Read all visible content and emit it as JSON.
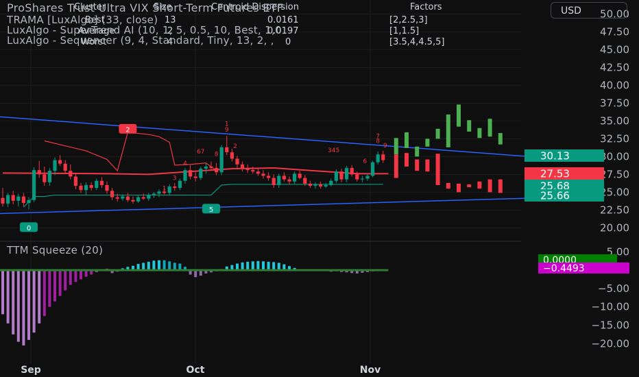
{
  "header": {
    "title": "ProShares Trust Ultra VIX Short-Term Futures ETF",
    "currency": "USD",
    "indicators": [
      "TRAMA [LuxAlgo] (33, close)",
      "LuxAlgo - SuperTrend AI (10, 1, 5, 0.5, 10, Best, 1,0",
      "LuxAlgo - Sequencer (9, 4, Standard, Tiny, 13, 2, ,"
    ]
  },
  "cluster_table": {
    "columns": [
      "Cluster",
      "Size",
      "Centroid Dispersion",
      "Factors"
    ],
    "rows": [
      [
        "Best",
        "13",
        "0.0161",
        "[2,2.5,3]"
      ],
      [
        "Average",
        "2",
        "0.0197",
        "[1,1.5]"
      ],
      [
        "Worst",
        "4",
        "0",
        "[3.5,4,4.5,5]"
      ]
    ]
  },
  "price_badges": [
    {
      "value": "30.13",
      "color": "#089981"
    },
    {
      "value": "27.53",
      "color": "#f23645"
    },
    {
      "value": "25.68",
      "color": "#089981"
    },
    {
      "value": "25.66",
      "color": "#089981"
    }
  ],
  "squeeze": {
    "title": "TTM Squeeze (20)",
    "badges": [
      {
        "value": "0.0000",
        "color": "#089981"
      },
      {
        "value": "−0.4493",
        "color": "#cc00cc"
      }
    ]
  },
  "chart_data": {
    "type": "candlestick",
    "x_ticks": [
      "Sep",
      "Oct",
      "Nov"
    ],
    "price_axis": {
      "ticks": [
        "20.00",
        "22.50",
        "25.00",
        "27.50",
        "30.00",
        "32.50",
        "35.00",
        "37.50",
        "40.00",
        "42.50",
        "45.00",
        "47.50",
        "50.00"
      ],
      "ylim": [
        18.5,
        51
      ]
    },
    "osc_axis": {
      "ticks": [
        "5.00",
        "0.00",
        "−5.00",
        "−10.00",
        "−15.00",
        "−20.00"
      ],
      "ylim": [
        -22,
        6
      ]
    },
    "sequencer_labels": [
      {
        "text": "2",
        "x": 24,
        "y": 33.8,
        "boxed": true,
        "color": "#f23645"
      },
      {
        "text": "0",
        "x": 5,
        "y": 20.0,
        "boxed": true,
        "color": "#089981"
      },
      {
        "text": "5",
        "x": 40,
        "y": 22.6,
        "boxed": true,
        "color": "#089981"
      },
      {
        "text": "1",
        "x": 31,
        "y": 25.3,
        "boxed": false,
        "color": "#f23645"
      },
      {
        "text": "3",
        "x": 33,
        "y": 26.7,
        "boxed": false,
        "color": "#f23645"
      },
      {
        "text": "4",
        "x": 35,
        "y": 28.8,
        "boxed": false,
        "color": "#f23645"
      },
      {
        "text": "67",
        "x": 38,
        "y": 30.4,
        "boxed": false,
        "color": "#f23645"
      },
      {
        "text": "8",
        "x": 41,
        "y": 30.1,
        "boxed": false,
        "color": "#f23645"
      },
      {
        "text": "1",
        "x": 43,
        "y": 34.3,
        "boxed": false,
        "color": "#f23645"
      },
      {
        "text": "9",
        "x": 43,
        "y": 33.5,
        "boxed": false,
        "color": "#f23645"
      },
      {
        "text": "2",
        "x": 44.6,
        "y": 31.2,
        "boxed": false,
        "color": "#f23645"
      },
      {
        "text": "345",
        "x": 63.5,
        "y": 30.6,
        "boxed": false,
        "color": "#f23645"
      },
      {
        "text": "6",
        "x": 69.5,
        "y": 29.1,
        "boxed": false,
        "color": "#f23645"
      },
      {
        "text": "7",
        "x": 72,
        "y": 32.6,
        "boxed": false,
        "color": "#f23645"
      },
      {
        "text": "8",
        "x": 72,
        "y": 31.9,
        "boxed": false,
        "color": "#f23645"
      },
      {
        "text": "9",
        "x": 73.4,
        "y": 31.3,
        "boxed": false,
        "color": "#f23645"
      }
    ],
    "candles": [
      {
        "o": 24.2,
        "h": 25.6,
        "l": 23.0,
        "c": 23.4
      },
      {
        "o": 23.4,
        "h": 24.9,
        "l": 22.9,
        "c": 24.6
      },
      {
        "o": 24.6,
        "h": 25.2,
        "l": 23.3,
        "c": 23.8
      },
      {
        "o": 23.8,
        "h": 24.8,
        "l": 23.0,
        "c": 24.4
      },
      {
        "o": 24.4,
        "h": 24.9,
        "l": 23.0,
        "c": 23.5
      },
      {
        "o": 23.5,
        "h": 24.3,
        "l": 22.6,
        "c": 23.9
      },
      {
        "o": 23.9,
        "h": 28.5,
        "l": 23.6,
        "c": 28.1
      },
      {
        "o": 28.1,
        "h": 29.4,
        "l": 27.0,
        "c": 27.5
      },
      {
        "o": 27.5,
        "h": 28.6,
        "l": 25.9,
        "c": 26.4
      },
      {
        "o": 26.4,
        "h": 28.4,
        "l": 25.9,
        "c": 28.0
      },
      {
        "o": 28.0,
        "h": 29.9,
        "l": 27.4,
        "c": 29.5
      },
      {
        "o": 29.5,
        "h": 30.2,
        "l": 28.7,
        "c": 29.0
      },
      {
        "o": 29.0,
        "h": 29.5,
        "l": 27.6,
        "c": 28.0
      },
      {
        "o": 28.0,
        "h": 28.9,
        "l": 26.8,
        "c": 27.2
      },
      {
        "o": 27.2,
        "h": 27.7,
        "l": 25.4,
        "c": 25.9
      },
      {
        "o": 25.9,
        "h": 26.3,
        "l": 24.9,
        "c": 25.3
      },
      {
        "o": 25.3,
        "h": 26.4,
        "l": 24.6,
        "c": 26.0
      },
      {
        "o": 26.0,
        "h": 26.4,
        "l": 25.2,
        "c": 25.6
      },
      {
        "o": 25.6,
        "h": 26.9,
        "l": 25.3,
        "c": 26.6
      },
      {
        "o": 26.6,
        "h": 27.1,
        "l": 25.6,
        "c": 26.0
      },
      {
        "o": 26.0,
        "h": 26.5,
        "l": 24.8,
        "c": 25.2
      },
      {
        "o": 25.2,
        "h": 25.6,
        "l": 23.9,
        "c": 24.3
      },
      {
        "o": 24.3,
        "h": 24.8,
        "l": 23.7,
        "c": 24.1
      },
      {
        "o": 24.1,
        "h": 24.7,
        "l": 23.8,
        "c": 24.4
      },
      {
        "o": 24.4,
        "h": 24.9,
        "l": 23.6,
        "c": 23.9
      },
      {
        "o": 23.9,
        "h": 24.4,
        "l": 23.4,
        "c": 23.7
      },
      {
        "o": 23.7,
        "h": 24.6,
        "l": 23.5,
        "c": 24.3
      },
      {
        "o": 24.3,
        "h": 24.8,
        "l": 23.9,
        "c": 24.1
      },
      {
        "o": 24.1,
        "h": 24.9,
        "l": 23.8,
        "c": 24.6
      },
      {
        "o": 24.6,
        "h": 25.0,
        "l": 24.2,
        "c": 24.8
      },
      {
        "o": 24.8,
        "h": 25.4,
        "l": 24.3,
        "c": 25.1
      },
      {
        "o": 25.1,
        "h": 25.6,
        "l": 24.7,
        "c": 24.9
      },
      {
        "o": 24.9,
        "h": 26.1,
        "l": 24.6,
        "c": 25.8
      },
      {
        "o": 25.8,
        "h": 26.3,
        "l": 25.2,
        "c": 25.6
      },
      {
        "o": 25.6,
        "h": 26.9,
        "l": 25.3,
        "c": 26.6
      },
      {
        "o": 26.6,
        "h": 28.4,
        "l": 26.2,
        "c": 28.1
      },
      {
        "o": 28.1,
        "h": 28.8,
        "l": 26.8,
        "c": 27.2
      },
      {
        "o": 27.2,
        "h": 27.8,
        "l": 26.5,
        "c": 27.0
      },
      {
        "o": 27.0,
        "h": 28.6,
        "l": 26.7,
        "c": 28.3
      },
      {
        "o": 28.3,
        "h": 29.0,
        "l": 27.6,
        "c": 28.6
      },
      {
        "o": 28.6,
        "h": 29.3,
        "l": 28.0,
        "c": 28.4
      },
      {
        "o": 28.4,
        "h": 29.1,
        "l": 27.4,
        "c": 27.8
      },
      {
        "o": 27.8,
        "h": 31.6,
        "l": 27.4,
        "c": 31.3
      },
      {
        "o": 31.3,
        "h": 32.9,
        "l": 30.2,
        "c": 30.6
      },
      {
        "o": 30.6,
        "h": 31.1,
        "l": 29.3,
        "c": 29.7
      },
      {
        "o": 29.7,
        "h": 30.1,
        "l": 28.4,
        "c": 28.9
      },
      {
        "o": 28.9,
        "h": 29.3,
        "l": 27.9,
        "c": 28.4
      },
      {
        "o": 28.4,
        "h": 28.9,
        "l": 27.7,
        "c": 28.1
      },
      {
        "o": 28.1,
        "h": 28.6,
        "l": 27.6,
        "c": 27.9
      },
      {
        "o": 27.9,
        "h": 28.3,
        "l": 27.3,
        "c": 27.6
      },
      {
        "o": 27.6,
        "h": 28.1,
        "l": 26.9,
        "c": 27.3
      },
      {
        "o": 27.3,
        "h": 27.8,
        "l": 26.6,
        "c": 27.0
      },
      {
        "o": 27.0,
        "h": 27.5,
        "l": 25.6,
        "c": 26.0
      },
      {
        "o": 26.0,
        "h": 27.6,
        "l": 25.6,
        "c": 27.3
      },
      {
        "o": 27.3,
        "h": 27.8,
        "l": 26.5,
        "c": 26.8
      },
      {
        "o": 26.8,
        "h": 27.2,
        "l": 26.1,
        "c": 26.5
      },
      {
        "o": 26.5,
        "h": 27.9,
        "l": 26.2,
        "c": 27.6
      },
      {
        "o": 27.6,
        "h": 28.0,
        "l": 26.8,
        "c": 27.0
      },
      {
        "o": 27.0,
        "h": 27.4,
        "l": 25.9,
        "c": 26.2
      },
      {
        "o": 26.2,
        "h": 26.6,
        "l": 25.6,
        "c": 25.9
      },
      {
        "o": 25.9,
        "h": 26.4,
        "l": 25.5,
        "c": 26.1
      },
      {
        "o": 26.1,
        "h": 26.5,
        "l": 25.5,
        "c": 25.8
      },
      {
        "o": 25.8,
        "h": 26.3,
        "l": 25.6,
        "c": 26.0
      },
      {
        "o": 26.0,
        "h": 26.9,
        "l": 25.8,
        "c": 26.6
      },
      {
        "o": 26.6,
        "h": 28.2,
        "l": 26.3,
        "c": 27.9
      },
      {
        "o": 27.9,
        "h": 28.3,
        "l": 26.4,
        "c": 26.8
      },
      {
        "o": 26.8,
        "h": 28.7,
        "l": 26.4,
        "c": 28.4
      },
      {
        "o": 28.4,
        "h": 28.8,
        "l": 27.2,
        "c": 27.5
      },
      {
        "o": 27.5,
        "h": 27.9,
        "l": 26.5,
        "c": 26.8
      },
      {
        "o": 26.8,
        "h": 27.3,
        "l": 26.4,
        "c": 26.9
      },
      {
        "o": 26.9,
        "h": 27.6,
        "l": 26.6,
        "c": 27.3
      },
      {
        "o": 27.3,
        "h": 29.4,
        "l": 27.1,
        "c": 29.2
      },
      {
        "o": 29.2,
        "h": 30.7,
        "l": 28.9,
        "c": 30.3
      },
      {
        "o": 30.3,
        "h": 30.8,
        "l": 29.1,
        "c": 29.5
      }
    ],
    "signal_bars": [
      {
        "x": 75.5,
        "from": 30.3,
        "to": 32.6,
        "color": "#4caf50"
      },
      {
        "x": 75.5,
        "from": 27.0,
        "to": 30.3,
        "color": "#f23645"
      },
      {
        "x": 77.5,
        "from": 31.2,
        "to": 33.4,
        "color": "#4caf50"
      },
      {
        "x": 77.5,
        "from": 28.6,
        "to": 30.5,
        "color": "#f23645"
      },
      {
        "x": 79.5,
        "from": 30.0,
        "to": 31.4,
        "color": "#4caf50"
      },
      {
        "x": 79.5,
        "from": 28.0,
        "to": 29.6,
        "color": "#f23645"
      },
      {
        "x": 81.5,
        "from": 31.4,
        "to": 32.5,
        "color": "#4caf50"
      },
      {
        "x": 81.5,
        "from": 27.9,
        "to": 29.6,
        "color": "#f23645"
      },
      {
        "x": 83.5,
        "from": 32.5,
        "to": 33.9,
        "color": "#4caf50"
      },
      {
        "x": 83.5,
        "from": 26.0,
        "to": 30.4,
        "color": "#f23645"
      },
      {
        "x": 85.5,
        "from": 31.3,
        "to": 35.9,
        "color": "#4caf50"
      },
      {
        "x": 85.5,
        "from": 25.5,
        "to": 26.3,
        "color": "#f23645"
      },
      {
        "x": 87.5,
        "from": 34.2,
        "to": 37.3,
        "color": "#4caf50"
      },
      {
        "x": 87.5,
        "from": 25.0,
        "to": 26.2,
        "color": "#f23645"
      },
      {
        "x": 89.5,
        "from": 33.5,
        "to": 35.1,
        "color": "#4caf50"
      },
      {
        "x": 89.5,
        "from": 25.7,
        "to": 26.1,
        "color": "#f23645"
      },
      {
        "x": 91.5,
        "from": 32.6,
        "to": 34.0,
        "color": "#4caf50"
      },
      {
        "x": 91.5,
        "from": 25.5,
        "to": 26.5,
        "color": "#f23645"
      },
      {
        "x": 93.5,
        "from": 32.8,
        "to": 35.3,
        "color": "#4caf50"
      },
      {
        "x": 93.5,
        "from": 25.0,
        "to": 26.8,
        "color": "#f23645"
      },
      {
        "x": 95.5,
        "from": 31.7,
        "to": 33.3,
        "color": "#4caf50"
      },
      {
        "x": 95.5,
        "from": 24.9,
        "to": 26.8,
        "color": "#f23645"
      }
    ],
    "trend_lines": [
      {
        "x1": -1,
        "y1": 35.6,
        "x2": 112,
        "y2": 29.4,
        "color": "#2962ff"
      },
      {
        "x1": -1,
        "y1": 22.0,
        "x2": 112,
        "y2": 24.4,
        "color": "#2962ff"
      }
    ],
    "trama": [
      [
        0,
        27.7
      ],
      [
        20,
        27.6
      ],
      [
        28,
        27.5
      ],
      [
        36,
        27.9
      ],
      [
        44,
        28.3
      ],
      [
        52,
        28.4
      ],
      [
        60,
        28.0
      ],
      [
        68,
        27.6
      ],
      [
        74,
        27.6
      ]
    ],
    "supertrend_red": [
      [
        8,
        32.2
      ],
      [
        12,
        31.5
      ],
      [
        16,
        30.8
      ],
      [
        20,
        29.6
      ],
      [
        22,
        28.0
      ],
      [
        24,
        33.4
      ],
      [
        28,
        33.1
      ],
      [
        30,
        32.8
      ],
      [
        32,
        32.0
      ],
      [
        33,
        28.8
      ],
      [
        36,
        28.9
      ],
      [
        39,
        29.1
      ],
      [
        41,
        28.0
      ]
    ],
    "supertrend_green": [
      [
        4,
        22.9
      ],
      [
        6,
        24.4
      ],
      [
        8,
        24.4
      ],
      [
        10,
        24.6
      ],
      [
        38,
        24.6
      ],
      [
        40,
        24.6
      ],
      [
        42,
        26.0
      ],
      [
        44,
        26.1
      ],
      [
        73,
        26.1
      ]
    ],
    "osc_bars": [
      -12.0,
      -14.5,
      -17.5,
      -19.5,
      -20.5,
      -19.0,
      -17.0,
      -14.5,
      -12.5,
      -10.0,
      -8.5,
      -7.0,
      -5.5,
      -4.0,
      -3.2,
      -2.5,
      -1.8,
      -1.2,
      -0.5,
      0.2,
      0.4,
      -0.8,
      -0.4,
      0.5,
      0.9,
      1.2,
      1.7,
      2.0,
      2.3,
      2.6,
      2.7,
      2.7,
      2.4,
      2.0,
      1.8,
      0.9,
      -1.2,
      -1.9,
      -1.5,
      -0.9,
      -0.6,
      -0.3,
      0.3,
      1.0,
      1.4,
      1.8,
      2.1,
      2.3,
      2.4,
      2.5,
      2.4,
      2.3,
      2.2,
      2.0,
      1.6,
      1.1,
      0.6,
      0.2,
      -0.1,
      -0.1,
      -0.2,
      -0.2,
      -0.2,
      -0.4,
      -0.3,
      -0.5,
      -0.6,
      -0.8,
      -0.9,
      -0.7,
      -0.5,
      -0.3,
      -0.1,
      0.1
    ]
  }
}
